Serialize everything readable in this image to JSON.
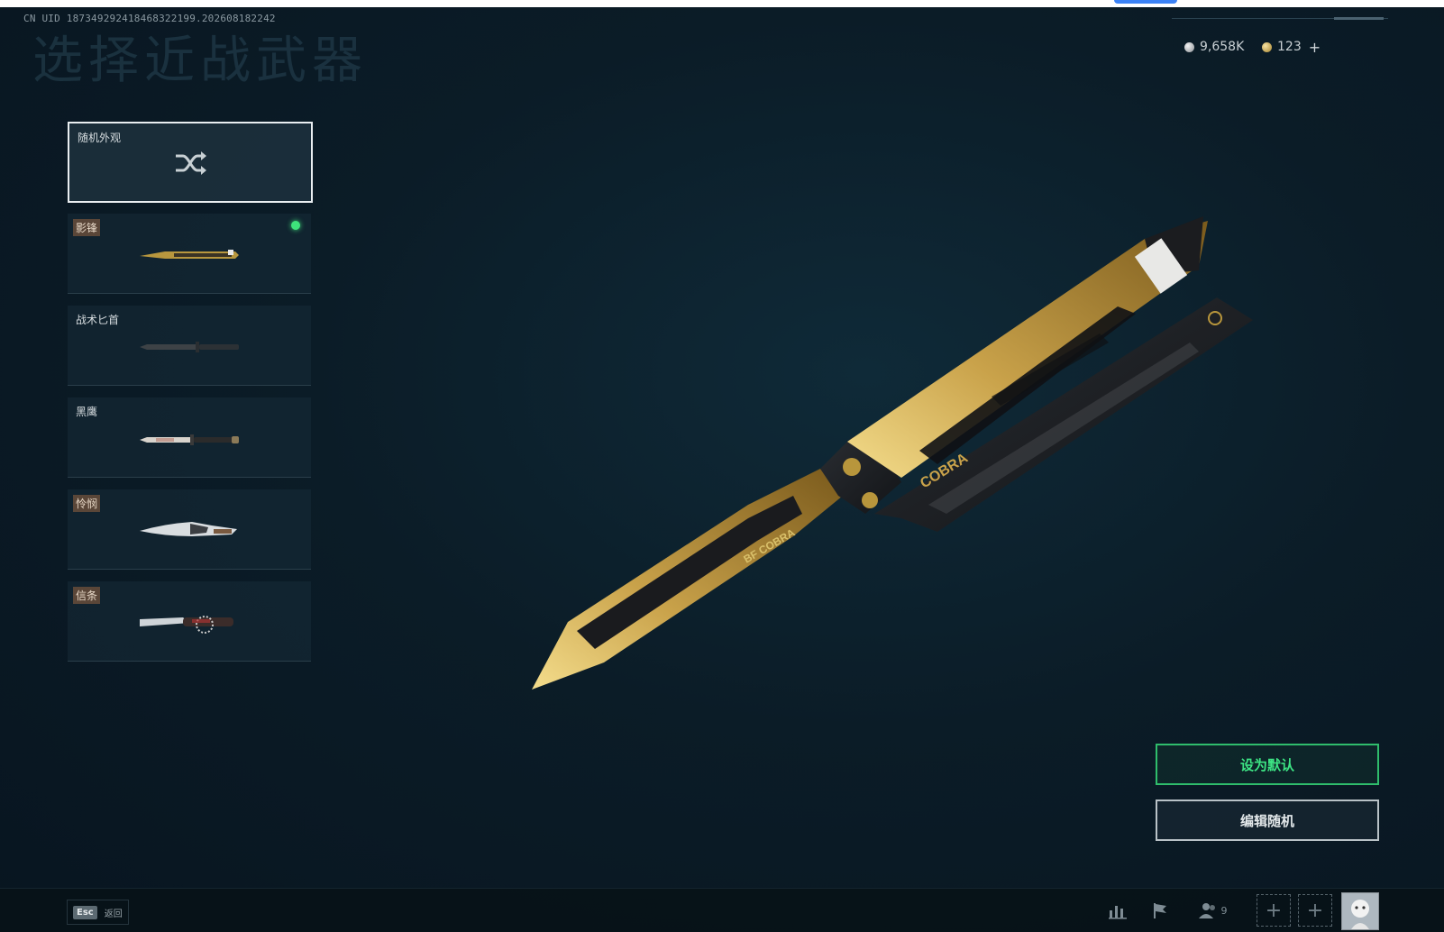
{
  "header": {
    "uid_text": "CN UID 18734929241846832219​9.202608182242",
    "title": "选择近战武器"
  },
  "currency": {
    "silver_value": "9,658K",
    "gold_value": "123",
    "add_label": "+"
  },
  "cards": [
    {
      "name": "随机外观",
      "selected": true
    },
    {
      "name": "影锋",
      "equipped": true
    },
    {
      "name": "战术匕首"
    },
    {
      "name": "黑鹰"
    },
    {
      "name": "怜悯"
    },
    {
      "name": "信条"
    }
  ],
  "knife": {
    "brand_text": "BF COBRA",
    "handle_text": "COBRA"
  },
  "buttons": {
    "set_default": "设为默认",
    "edit_random": "编辑随机"
  },
  "footer": {
    "esc_key": "Esc",
    "esc_label": "返回",
    "squad_count": "9",
    "add_slot": "+"
  },
  "colors": {
    "accent_green": "#3de484",
    "tag_brown": "#5a4638",
    "equipped_dot": "#3ee27b"
  }
}
